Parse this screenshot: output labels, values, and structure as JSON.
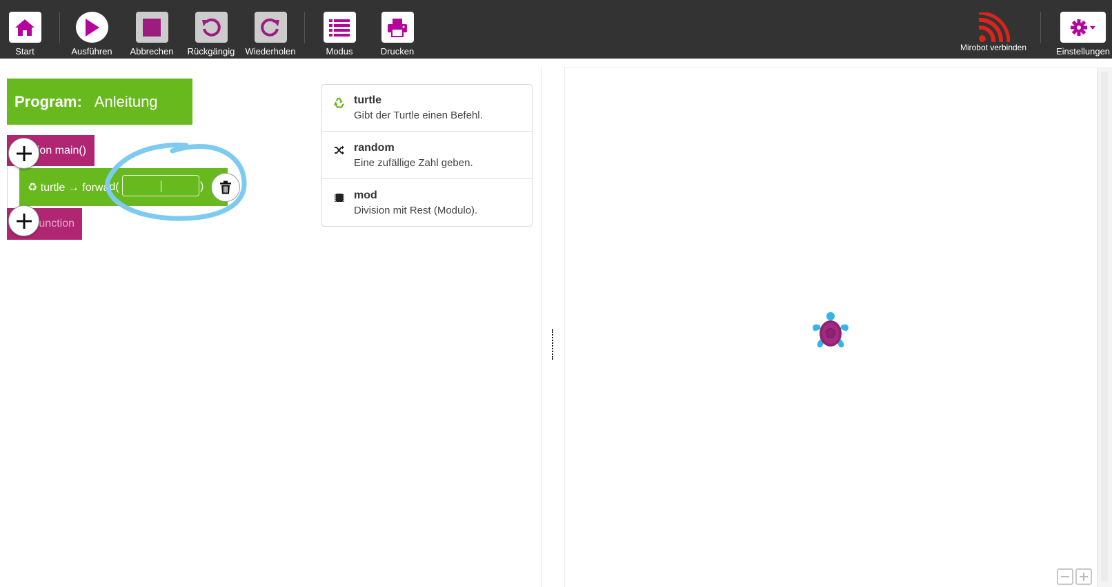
{
  "toolbar": {
    "buttons": [
      {
        "label": "Start",
        "icon": "home-icon"
      },
      {
        "label": "Ausführen",
        "icon": "play-icon"
      },
      {
        "label": "Abbrechen",
        "icon": "stop-icon"
      },
      {
        "label": "Rückgängig",
        "icon": "undo-icon"
      },
      {
        "label": "Wiederholen",
        "icon": "redo-icon"
      },
      {
        "label": "Modus",
        "icon": "list-icon"
      },
      {
        "label": "Drucken",
        "icon": "print-icon"
      }
    ],
    "mirobot": {
      "label": "Mirobot verbinden",
      "icon": "wifi-signal-icon"
    },
    "settings": {
      "label": "Einstellungen",
      "icon": "gear-icon"
    }
  },
  "editor": {
    "program_label": "Program:",
    "program_name": "Anleitung",
    "function_header": "ion main()",
    "function_end": "unction",
    "statement_text": "♻ turtle → forwa",
    "statement_tail": "d(",
    "param_value": "",
    "paren_close": ")"
  },
  "suggestions": [
    {
      "name": "turtle",
      "desc": "Gibt der Turtle einen Befehl.",
      "icon": "recycle-icon"
    },
    {
      "name": "random",
      "desc": "Eine zufällige Zahl geben.",
      "icon": "shuffle-icon"
    },
    {
      "name": "mod",
      "desc": "Division mit Rest (Modulo).",
      "icon": "chip-icon"
    }
  ],
  "colors": {
    "toolbar_bg": "#333333",
    "accent": "#b5049c",
    "block_green": "#67b91d",
    "block_magenta": "#b02673",
    "highlight": "#7dcbf0",
    "mirobot_red": "#d9251c"
  }
}
